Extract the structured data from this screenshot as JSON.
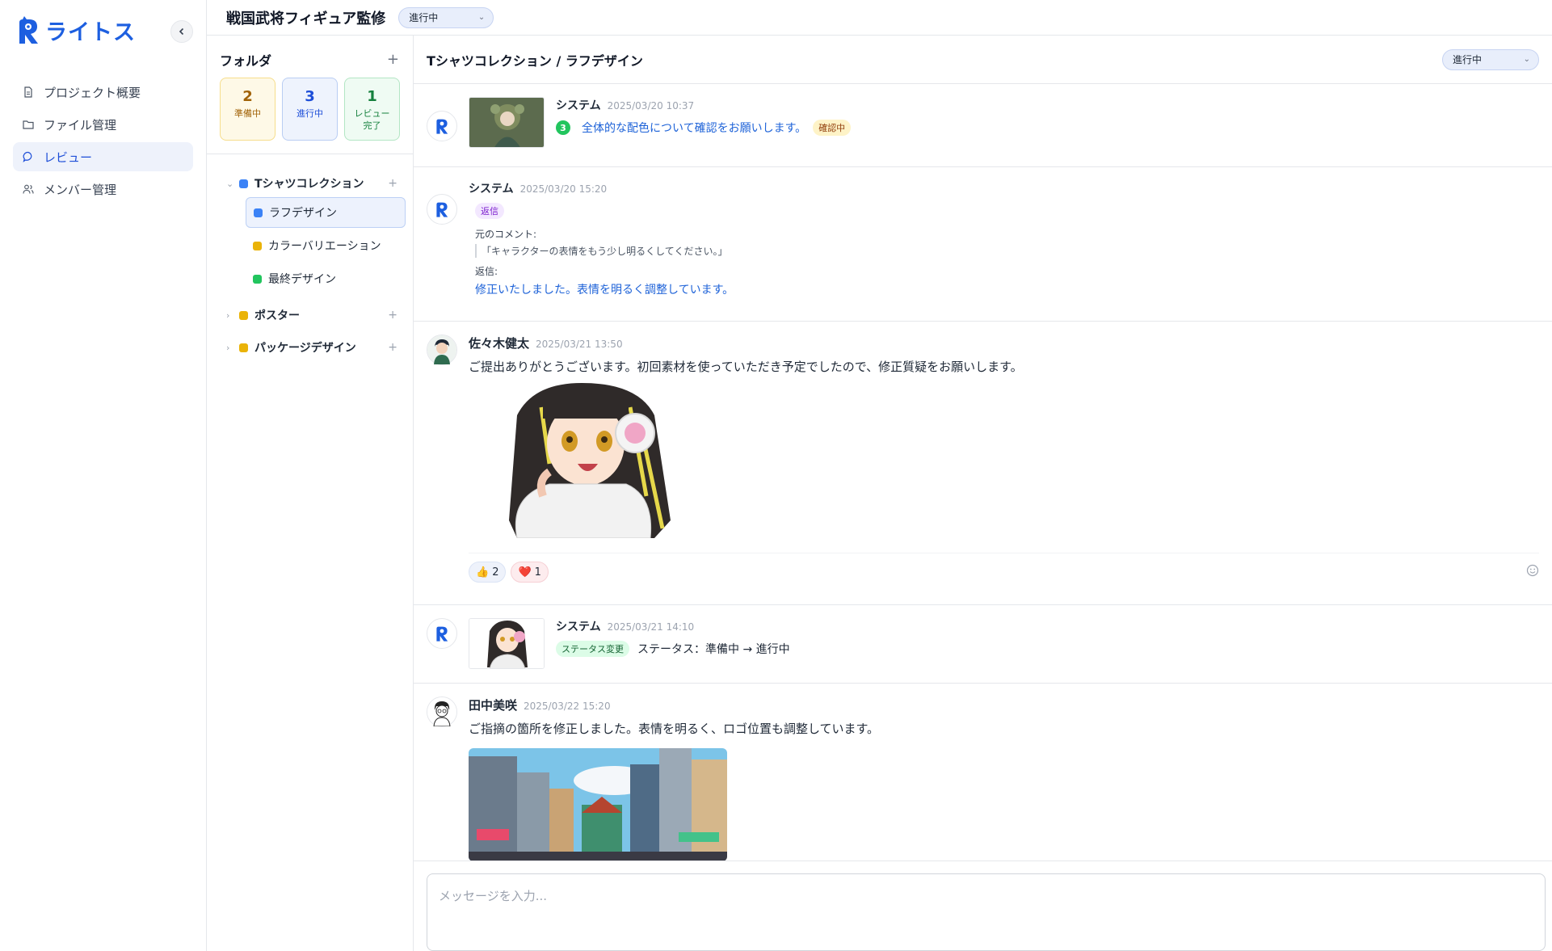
{
  "app": {
    "logo_text": "ライトス"
  },
  "nav": {
    "items": [
      {
        "label": "プロジェクト概要",
        "icon": "document-icon"
      },
      {
        "label": "ファイル管理",
        "icon": "folder-icon"
      },
      {
        "label": "レビュー",
        "icon": "chat-icon",
        "active": true
      },
      {
        "label": "メンバー管理",
        "icon": "users-icon"
      }
    ]
  },
  "header": {
    "project_title": "戦国武将フィギュア監修",
    "status": "進行中"
  },
  "folders": {
    "title": "フォルダ",
    "stats": [
      {
        "count": "2",
        "label": "準備中"
      },
      {
        "count": "3",
        "label": "進行中"
      },
      {
        "count": "1",
        "label": "レビュー完了"
      }
    ],
    "tree": [
      {
        "label": "Tシャツコレクション",
        "color": "#3b82f6",
        "expanded": true,
        "children": [
          {
            "label": "ラフデザイン",
            "color": "#3b82f6",
            "active": true
          },
          {
            "label": "カラーバリエーション",
            "color": "#eab308"
          },
          {
            "label": "最終デザイン",
            "color": "#22c55e"
          }
        ]
      },
      {
        "label": "ポスター",
        "color": "#eab308",
        "expanded": false
      },
      {
        "label": "パッケージデザイン",
        "color": "#eab308",
        "expanded": false
      }
    ]
  },
  "chat": {
    "title": "Tシャツコレクション / ラフデザイン",
    "status": "進行中",
    "messages": [
      {
        "author": "システム",
        "time": "2025/03/20 10:37",
        "number": "3",
        "text": "全体的な配色について確認をお願いします。",
        "badge": "確認中"
      },
      {
        "author": "システム",
        "time": "2025/03/20 15:20",
        "badge": "返信",
        "original_label": "元のコメント:",
        "original_text": "「キャラクターの表情をもう少し明るくしてください。」",
        "reply_label": "返信:",
        "reply_text": "修正いたしました。表情を明るく調整しています。"
      },
      {
        "author": "佐々木健太",
        "time": "2025/03/21 13:50",
        "text": "ご提出ありがとうございます。初回素材を使っていただき予定でしたので、修正質疑をお願いします。",
        "reactions": [
          {
            "emoji": "👍",
            "count": "2"
          },
          {
            "emoji": "❤️",
            "count": "1"
          }
        ]
      },
      {
        "author": "システム",
        "time": "2025/03/21 14:10",
        "badge": "ステータス変更",
        "text": "ステータス：準備中 → 進行中"
      },
      {
        "author": "田中美咲",
        "time": "2025/03/22 15:20",
        "text": "ご指摘の箇所を修正しました。表情を明るく、ロゴ位置も調整しています。"
      }
    ],
    "composer_placeholder": "メッセージを入力..."
  }
}
